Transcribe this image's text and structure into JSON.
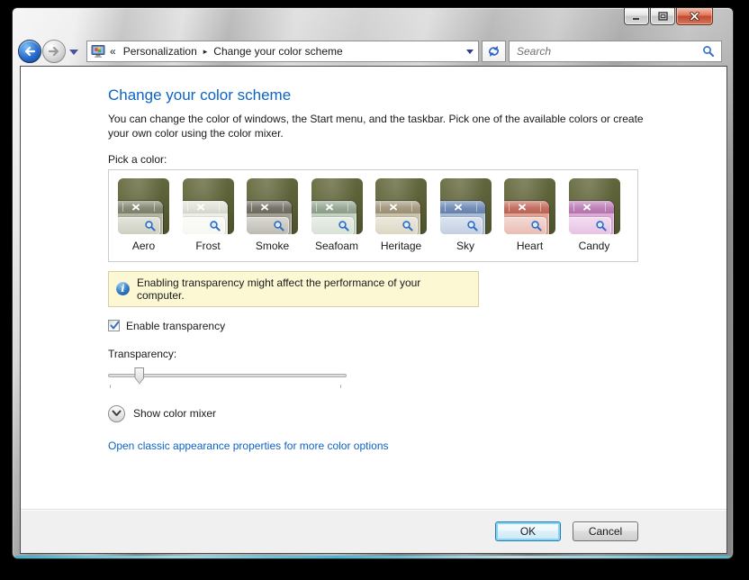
{
  "titlebar": {
    "controls": {
      "minimize": "minimize",
      "maximize": "maximize",
      "close": "close"
    }
  },
  "navbar": {
    "breadcrumb": {
      "overflow_chevron": "«",
      "root": "Personalization",
      "separator": "▸",
      "current": "Change your color scheme"
    },
    "search_placeholder": "Search"
  },
  "page": {
    "title": "Change your color scheme",
    "description": "You can change the color of windows, the Start menu, and the taskbar. Pick one of the available colors or create your own color using the color mixer.",
    "pick_color_label": "Pick a color:",
    "schemes": [
      {
        "name": "Aero",
        "titlebar": "#82866f",
        "body": "#b4b6a2",
        "pill": "#c9cbba"
      },
      {
        "name": "Frost",
        "titlebar": "#dfe2d8",
        "body": "#edefe6",
        "pill": "#f6f7f1"
      },
      {
        "name": "Smoke",
        "titlebar": "#716e62",
        "body": "#a3a095",
        "pill": "#b6b3a9"
      },
      {
        "name": "Seafoam",
        "titlebar": "#93a691",
        "body": "#c4d2c1",
        "pill": "#d4dfd1"
      },
      {
        "name": "Heritage",
        "titlebar": "#a2977c",
        "body": "#cbc3a9",
        "pill": "#d9d3bd"
      },
      {
        "name": "Sky",
        "titlebar": "#6c88b4",
        "body": "#a9bdd7",
        "pill": "#bccadf"
      },
      {
        "name": "Heart",
        "titlebar": "#c2695a",
        "body": "#dfa294",
        "pill": "#e7b6ab"
      },
      {
        "name": "Candy",
        "titlebar": "#bb7cb6",
        "body": "#dcaad7",
        "pill": "#e5bce1"
      }
    ],
    "info_banner": "Enabling transparency might affect the performance of your computer.",
    "enable_transparency": {
      "label": "Enable transparency",
      "checked": true
    },
    "transparency_slider": {
      "label": "Transparency:",
      "value_percent": 13
    },
    "show_color_mixer": "Show color mixer",
    "classic_link": "Open classic appearance properties for more color options"
  },
  "footer": {
    "ok": "OK",
    "cancel": "Cancel"
  },
  "theme": {
    "heading_color": "#0d64c5",
    "link_color": "#0c62c7",
    "info_bg": "#fcf8d4",
    "info_border": "#d6d0a0",
    "desktop_olive": "#5d6138"
  }
}
